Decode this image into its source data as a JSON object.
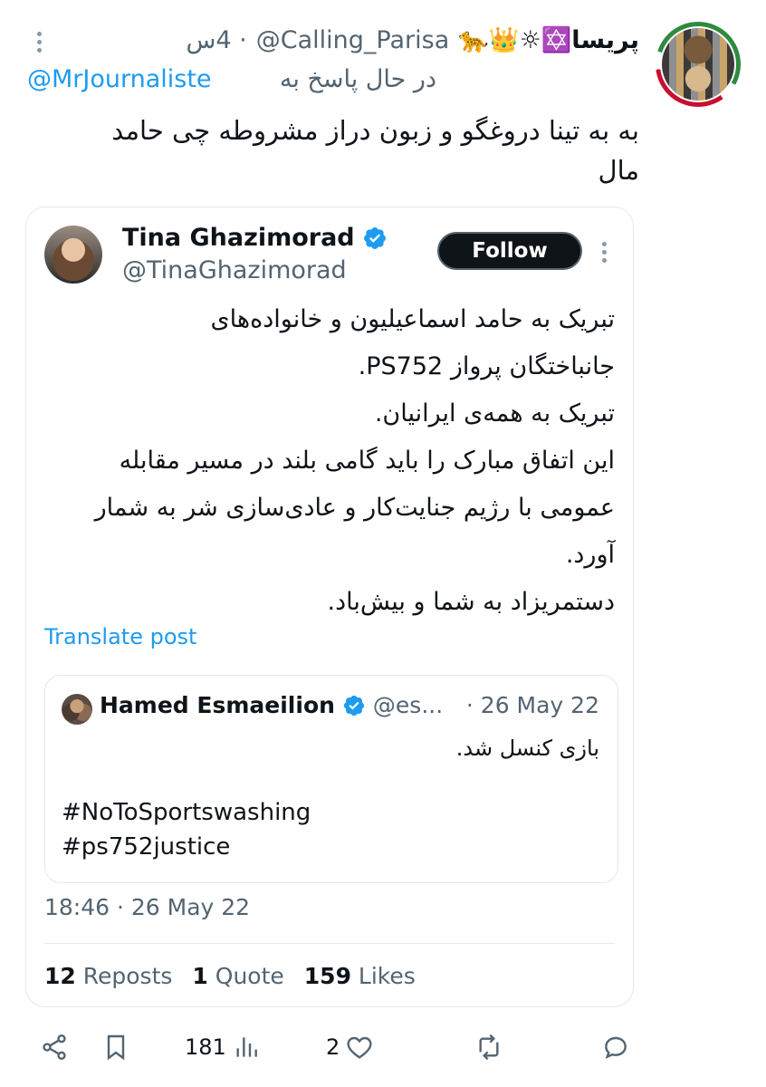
{
  "reply": {
    "display_name": "پریسا✡️☼👑🐆",
    "handle": "@Calling_Parisa",
    "timestamp": "· 4س",
    "reply_to_label": "در حال پاسخ به",
    "reply_to_handle": "@MrJournaliste",
    "text": "به به تینا دروغگو و زبون دراز مشروطه چی حامد مال"
  },
  "quoted": {
    "display_name": "Tina Ghazimorad",
    "handle": "@TinaGhazimorad",
    "follow_label": "Follow",
    "body_lines": [
      "تبریک به حامد اسماعیلیون و خانواده‌های",
      "جانباختگان پرواز PS752.",
      "تبریک به همه‌ی ایرانیان.",
      "این اتفاق مبارک را باید گامی بلند در مسیر مقابله",
      "عمومی با رژیم جنایت‌کار و عادی‌سازی شر به شمار",
      "آورد.",
      "دستمریزاد به شما و بیش‌باد."
    ],
    "translate_label": "Translate post",
    "timestamp": "18:46 · 26 May 22",
    "stats": {
      "reposts_count": "12",
      "reposts_label": "Reposts",
      "quotes_count": "1",
      "quotes_label": "Quote",
      "likes_count": "159",
      "likes_label": "Likes"
    },
    "nested": {
      "display_name": "Hamed Esmaeilion",
      "handle": "@es...",
      "date": "· 26 May 22",
      "text": "بازی کنسل شد.",
      "hashtag_1": "#NoToSportswashing",
      "hashtag_2": "#ps752justice"
    }
  },
  "actions": {
    "share_icon": "share-icon",
    "bookmark_icon": "bookmark-icon",
    "views_count": "181",
    "likes_count": "2",
    "repost_icon": "repost-icon",
    "reply_icon": "reply-icon"
  },
  "colors": {
    "link": "#1d9bf0",
    "secondary_text": "#536471",
    "primary_text": "#0f1419",
    "border": "#e1e8ed",
    "follow_bg": "#0f1419"
  }
}
